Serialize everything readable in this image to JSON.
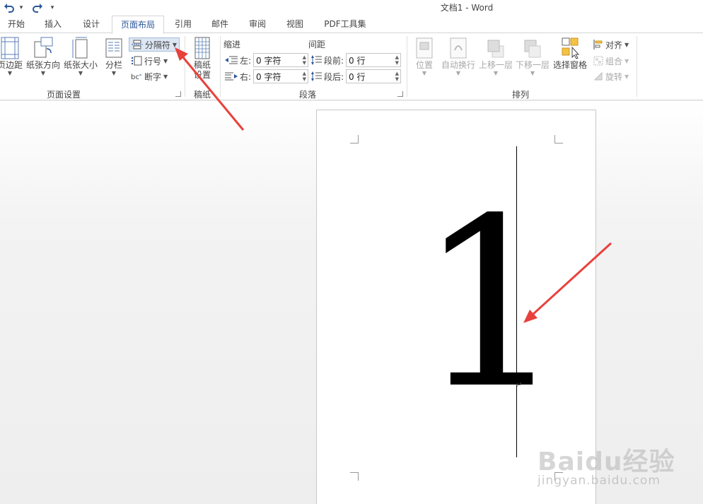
{
  "window": {
    "title": "文档1 - Word"
  },
  "qat": {
    "undo_icon": "undo-icon",
    "redo_icon": "redo-icon",
    "customize_caret": "▾"
  },
  "tabs": [
    {
      "label": "开始"
    },
    {
      "label": "插入"
    },
    {
      "label": "设计"
    },
    {
      "label": "页面布局",
      "active": true
    },
    {
      "label": "引用"
    },
    {
      "label": "邮件"
    },
    {
      "label": "审阅"
    },
    {
      "label": "视图"
    },
    {
      "label": "PDF工具集"
    }
  ],
  "ribbon": {
    "page_setup": {
      "label": "页面设置",
      "margins": "页边距",
      "orientation": "纸张方向",
      "size": "纸张大小",
      "columns": "分栏",
      "breaks": "分隔符",
      "line_numbers": "行号",
      "hyphenation": "断字"
    },
    "manuscript": {
      "label": "稿纸",
      "settings_line1": "稿纸",
      "settings_line2": "设置"
    },
    "paragraph": {
      "label": "段落",
      "indent_title": "缩进",
      "spacing_title": "间距",
      "left_label": "左:",
      "left_value": "0 字符",
      "right_label": "右:",
      "right_value": "0 字符",
      "before_label": "段前:",
      "before_value": "0 行",
      "after_label": "段后:",
      "after_value": "0 行"
    },
    "arrange": {
      "label": "排列",
      "position": "位置",
      "wrap_text": "自动换行",
      "bring_forward": "上移一层",
      "send_backward": "下移一层",
      "selection_pane": "选择窗格",
      "align": "对齐",
      "group": "组合",
      "rotate": "旋转"
    }
  },
  "document": {
    "content": "1",
    "paragraph_mark": "↵"
  },
  "watermark": {
    "logo": "Baidu经验",
    "url": "jingyan.baidu.com"
  },
  "colors": {
    "accent": "#2b579a",
    "annotation_arrow": "#e8413b"
  }
}
